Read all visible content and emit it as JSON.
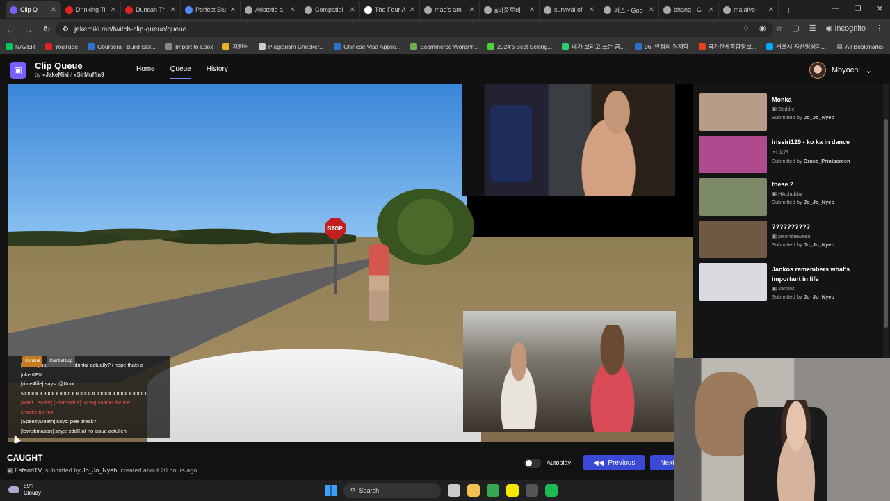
{
  "browser": {
    "tabs": [
      {
        "title": "Clip Q",
        "color": "#7b5cff",
        "active": true
      },
      {
        "title": "Drinking Ti",
        "color": "#e02424"
      },
      {
        "title": "Duncan Tr",
        "color": "#e02424"
      },
      {
        "title": "Perfect Blu",
        "color": "#4d8cf5"
      },
      {
        "title": "Aristotle a",
        "color": "#aaaaaa"
      },
      {
        "title": "Compatibi",
        "color": "#aaaaaa"
      },
      {
        "title": "The Four A",
        "color": "#ffffff"
      },
      {
        "title": "mao's am",
        "color": "#aaaaaa"
      },
      {
        "title": "a마중루비",
        "color": "#aaaaaa"
      },
      {
        "title": "survival of",
        "color": "#aaaaaa"
      },
      {
        "title": "퍼스 - Goo",
        "color": "#aaaaaa"
      },
      {
        "title": "bhang - G",
        "color": "#aaaaaa"
      },
      {
        "title": "malaiyo -",
        "color": "#aaaaaa"
      }
    ],
    "url": "jakemiki.me/twitch-clip-queue/queue",
    "incognito_label": "Incognito",
    "bookmarks": [
      {
        "label": "NAVER",
        "color": "#03c75a"
      },
      {
        "label": "YouTube",
        "color": "#e02424"
      },
      {
        "label": "Coursera | Build Skil...",
        "color": "#2a73cc"
      },
      {
        "label": "Import to Loox",
        "color": "#888888"
      },
      {
        "label": "지원어",
        "color": "#e6b422"
      },
      {
        "label": "Plagiarism Checker...",
        "color": "#cccccc"
      },
      {
        "label": "Chinese Visa Applic...",
        "color": "#2a73cc"
      },
      {
        "label": "Ecommerce WordPr...",
        "color": "#6ab04c"
      },
      {
        "label": "2024's Best Selling...",
        "color": "#4cd137"
      },
      {
        "label": "내가 보려고 쓰는 곰...",
        "color": "#2ecc71"
      },
      {
        "label": "06. 인접의 경제학",
        "color": "#2a73cc"
      },
      {
        "label": "국가관세종합정보...",
        "color": "#e84118"
      },
      {
        "label": "서울시 자산형성지...",
        "color": "#00a8ff"
      }
    ],
    "all_bookmarks_label": "All Bookmarks"
  },
  "app": {
    "title": "Clip Queue",
    "by_prefix": "by",
    "author1": "JakeMiki",
    "separator": "/",
    "author2": "SirMuffin9",
    "nav": {
      "home": "Home",
      "queue": "Queue",
      "history": "History"
    },
    "username": "Mhyochi"
  },
  "video": {
    "stop_text": "STOP",
    "chat_tabs": [
      "General",
      "Combat Log"
    ],
    "chat": [
      {
        "text": "[neemx] says: @correedrinkz actually? i hope thats a",
        "red": false
      },
      {
        "text": "joke KEK",
        "red": false
      },
      {
        "text": "[rime4life] says: @Knut",
        "red": false
      },
      {
        "text": "NOOOOOOOOOOOOOOOOOOOOOOOOOOOOOO",
        "red": false
      },
      {
        "text": "[Raid Leader] [Stormwind]: Bring snacks for me",
        "red": true
      },
      {
        "text": "snacks for me",
        "red": true
      },
      {
        "text": "[SpeezyDeath] says: pee break?",
        "red": false
      },
      {
        "text": "[lewiskmason] says: xddKlat no issue actulleh",
        "red": false
      }
    ]
  },
  "current_clip": {
    "title": "CAUGHT",
    "channel": "EsfandTV",
    "submitted_prefix": ", submitted by",
    "submitter": "Jo_Jo_Nyeb",
    "created": ", created about 20 hours ago"
  },
  "controls": {
    "autoplay_label": "Autoplay",
    "previous_label": "Previous",
    "next_label": "Next"
  },
  "queue": [
    {
      "title": "Monka",
      "channel": "Beddle",
      "submitted_prefix": "Submitted by",
      "submitter": "Jo_Jo_Nyeb",
      "thumb": "#b79c8a"
    },
    {
      "title": "irissiri129 - ko ka in dance",
      "channel": "꼬밴",
      "submitted_prefix": "Submitted by",
      "submitter": "Bruce_Printscreen",
      "thumb": "#b04a8e"
    },
    {
      "title": "these 2",
      "channel": "HAchubby",
      "submitted_prefix": "Submitted by",
      "submitter": "Jo_Jo_Nyeb",
      "thumb": "#7d8a6a"
    },
    {
      "title": "??????????",
      "channel": "jasontheween",
      "submitted_prefix": "Submitted by",
      "submitter": "Jo_Jo_Nyeb",
      "thumb": "#6e5a44"
    },
    {
      "title": "Jankos remembers what's important in life",
      "channel": "Jankos",
      "submitted_prefix": "Submitted by",
      "submitter": "Jo_Jo_Nyeb",
      "thumb": "#d9dbe0"
    }
  ],
  "taskbar": {
    "temp": "59°F",
    "condition": "Cloudy",
    "search_label": "Search",
    "icons": [
      {
        "name": "task-view-icon",
        "color": "#cccccc"
      },
      {
        "name": "file-explorer-icon",
        "color": "#f2c14e"
      },
      {
        "name": "chrome-icon",
        "color": "#34a853"
      },
      {
        "name": "kakaotalk-icon",
        "color": "#f7e600"
      },
      {
        "name": "steam-icon",
        "color": "#555555"
      },
      {
        "name": "spotify-icon",
        "color": "#1db954"
      }
    ]
  }
}
